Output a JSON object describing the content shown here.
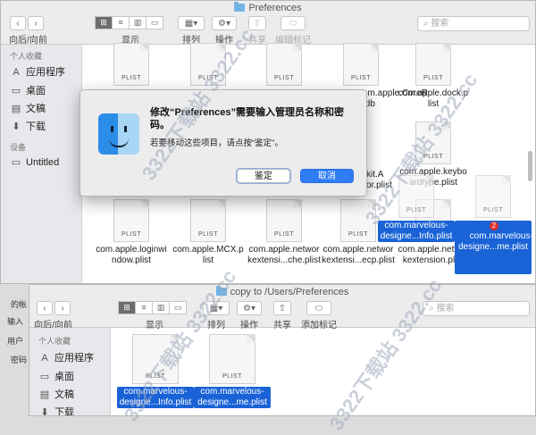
{
  "top_window": {
    "title": "Preferences",
    "nav_label": "向后/向前",
    "toolbar": {
      "view": "显示",
      "arrange": "排列",
      "action": "操作",
      "share": "共享",
      "tags": "编辑标记"
    },
    "search_placeholder": "搜索",
    "sidebar": {
      "favorites_header": "个人收藏",
      "applications": "应用程序",
      "desktop": "桌面",
      "documents": "文稿",
      "downloads": "下载",
      "devices_header": "设备",
      "untitled": "Untitled"
    },
    "files": [
      {
        "name": "com.apple.loginwi\nndow.plist"
      },
      {
        "name": "com.apple.MCX.p\nlist"
      },
      {
        "name": "com.apple.networ\nkextensi...che.plist"
      },
      {
        "name": "com.apple.networ\nkextensi...ecp.plist"
      },
      {
        "name": "com.apple.networ\nkextension.plist"
      }
    ],
    "partial_names": {
      "core_r": "com.apple.CoreR\ncfdb",
      "dock": "com.apple.dock.p\nlist",
      "kit_a": "kit.A\nor.plist",
      "keyboard": "com.apple.keybo\nardtype.plist"
    },
    "selected_files": [
      {
        "name": "com.marvelous-\ndesigne...Info.plist"
      },
      {
        "name": "com.marvelous-\ndesigne...me.plist",
        "badge": "2"
      }
    ],
    "icon_label": "PLIST"
  },
  "dialog": {
    "title": "修改“Preferences”需要输入管理员名称和密码。",
    "message": "若要移动这些项目，请点按“鉴定”。",
    "authenticate_button": "鉴定",
    "cancel_button": "取消"
  },
  "bottom_window": {
    "title": "copy to /Users/Preferences",
    "nav_label": "向后/向前",
    "toolbar": {
      "view": "显示",
      "arrange": "排列",
      "action": "操作",
      "share": "共享",
      "tags": "添加标记"
    },
    "search_placeholder": "搜索",
    "sidebar": {
      "favorites_header": "个人收藏",
      "applications": "应用程序",
      "desktop": "桌面",
      "documents": "文稿",
      "downloads": "下载"
    },
    "files": [
      {
        "name": "com.marvelous-\ndesigne...Info.plist"
      },
      {
        "name": "com.marvelous-\ndesigne...me.plist"
      }
    ],
    "icon_label": "PLIST"
  },
  "behind_labels": {
    "a": "输入",
    "b": "用户",
    "c": "密码",
    "d": "的帐"
  },
  "watermark": "3322下载站 3322.cc"
}
